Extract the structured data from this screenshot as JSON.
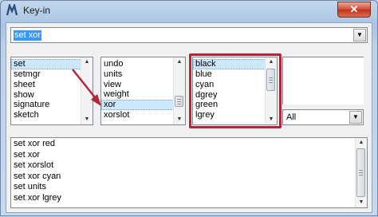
{
  "window": {
    "title": "Key-in",
    "close_label": "✕"
  },
  "command_input": {
    "value": "set xor"
  },
  "lists": {
    "commands": [
      "set",
      "setmgr",
      "sheet",
      "show",
      "signature",
      "sketch"
    ],
    "options": [
      "undo",
      "units",
      "view",
      "weight",
      "xor",
      "xorslot"
    ],
    "values": [
      "black",
      "blue",
      "cyan",
      "dgrey",
      "green",
      "lgrey"
    ]
  },
  "filter_combo": {
    "value": "All"
  },
  "history": [
    "set xor red",
    "set xor",
    "set xorslot",
    "set xor cyan",
    "set units",
    "set xor lgrey"
  ],
  "colors": {
    "annotation": "#b3253b",
    "selection": "#3399ff",
    "close_button": "#c8442c"
  }
}
